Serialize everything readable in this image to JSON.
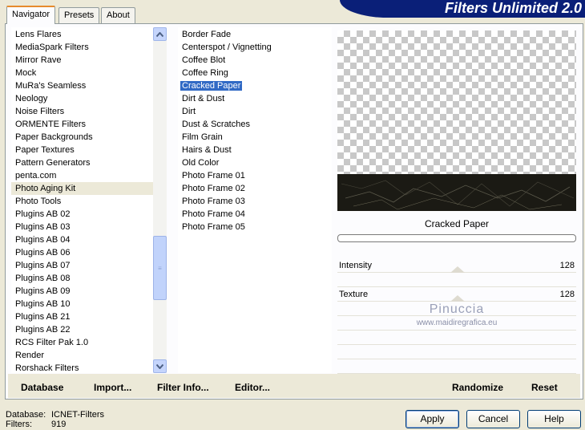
{
  "app": {
    "title": "Filters Unlimited 2.0"
  },
  "tabs": [
    {
      "label": "Navigator"
    },
    {
      "label": "Presets"
    },
    {
      "label": "About"
    }
  ],
  "categories": {
    "items": [
      "Lens Flares",
      "MediaSpark Filters",
      "Mirror Rave",
      "Mock",
      "MuRa's Seamless",
      "Neology",
      "Noise Filters",
      "ORMENTE Filters",
      "Paper Backgrounds",
      "Paper Textures",
      "Pattern Generators",
      "penta.com",
      "Photo Aging Kit",
      "Photo Tools",
      "Plugins AB 02",
      "Plugins AB 03",
      "Plugins AB 04",
      "Plugins AB 06",
      "Plugins AB 07",
      "Plugins AB 08",
      "Plugins AB 09",
      "Plugins AB 10",
      "Plugins AB 21",
      "Plugins AB 22",
      "RCS Filter Pak 1.0",
      "Render",
      "Rorshack Filters"
    ],
    "selected": "Photo Aging Kit"
  },
  "filters": {
    "items": [
      "Border Fade",
      "Centerspot / Vignetting",
      "Coffee Blot",
      "Coffee Ring",
      "Cracked Paper",
      "Dirt & Dust",
      "Dirt",
      "Dust & Scratches",
      "Film Grain",
      "Hairs & Dust",
      "Old Color",
      "Photo Frame 01",
      "Photo Frame 02",
      "Photo Frame 03",
      "Photo Frame 04",
      "Photo Frame 05"
    ],
    "selected": "Cracked Paper"
  },
  "preview": {
    "filter_name": "Cracked Paper",
    "params": [
      {
        "label": "Intensity",
        "value": "128"
      },
      {
        "label": "Texture",
        "value": "128"
      }
    ],
    "watermark": {
      "line1": "Pinuccia",
      "line2": "www.maidiregrafica.eu"
    }
  },
  "toolbar": {
    "database": "Database",
    "import": "Import...",
    "filter_info": "Filter Info...",
    "editor": "Editor...",
    "randomize": "Randomize",
    "reset": "Reset"
  },
  "status": {
    "database_label": "Database:",
    "database_value": "ICNET-Filters",
    "filters_label": "Filters:",
    "filters_value": "919"
  },
  "buttons": {
    "apply": "Apply",
    "cancel": "Cancel",
    "help": "Help"
  },
  "colors": {
    "banner": "#0a1f78",
    "selection": "#316ac5",
    "tab_highlight": "#e68b2c"
  }
}
